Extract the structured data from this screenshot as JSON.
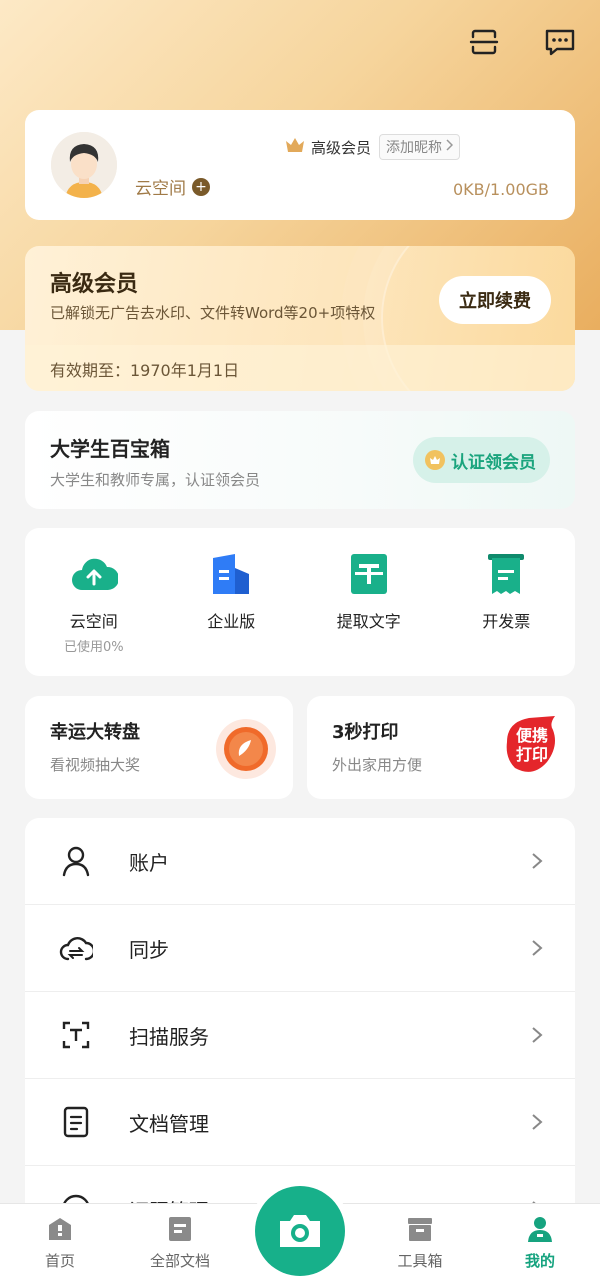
{
  "profile": {
    "level_label": "高级会员",
    "nickname_button": "添加昵称",
    "cloud_label": "云空间",
    "storage": "0KB/1.00GB"
  },
  "vip": {
    "title": "高级会员",
    "description": "已解锁无广告去水印、文件转Word等20+项特权",
    "renew_button": "立即续费",
    "expiry": "有效期至：1970年1月1日"
  },
  "student": {
    "title": "大学生百宝箱",
    "description": "大学生和教师专属，认证领会员",
    "cert_button": "认证领会员"
  },
  "quick_actions": [
    {
      "label": "云空间",
      "sub": "已使用0%"
    },
    {
      "label": "企业版",
      "sub": ""
    },
    {
      "label": "提取文字",
      "sub": ""
    },
    {
      "label": "开发票",
      "sub": ""
    }
  ],
  "promos": [
    {
      "title": "幸运大转盘",
      "desc": "看视频抽大奖"
    },
    {
      "title": "3秒打印",
      "desc": "外出家用方便",
      "badge_line1": "便携",
      "badge_line2": "打印"
    }
  ],
  "menu": [
    {
      "label": "账户"
    },
    {
      "label": "同步"
    },
    {
      "label": "扫描服务"
    },
    {
      "label": "文档管理"
    },
    {
      "label": "证照管理"
    }
  ],
  "tabs": [
    {
      "label": "首页"
    },
    {
      "label": "全部文档"
    },
    {
      "label": "工具箱"
    },
    {
      "label": "我的"
    }
  ],
  "colors": {
    "accent_green": "#17b08a",
    "gold": "#e9ae5f"
  }
}
